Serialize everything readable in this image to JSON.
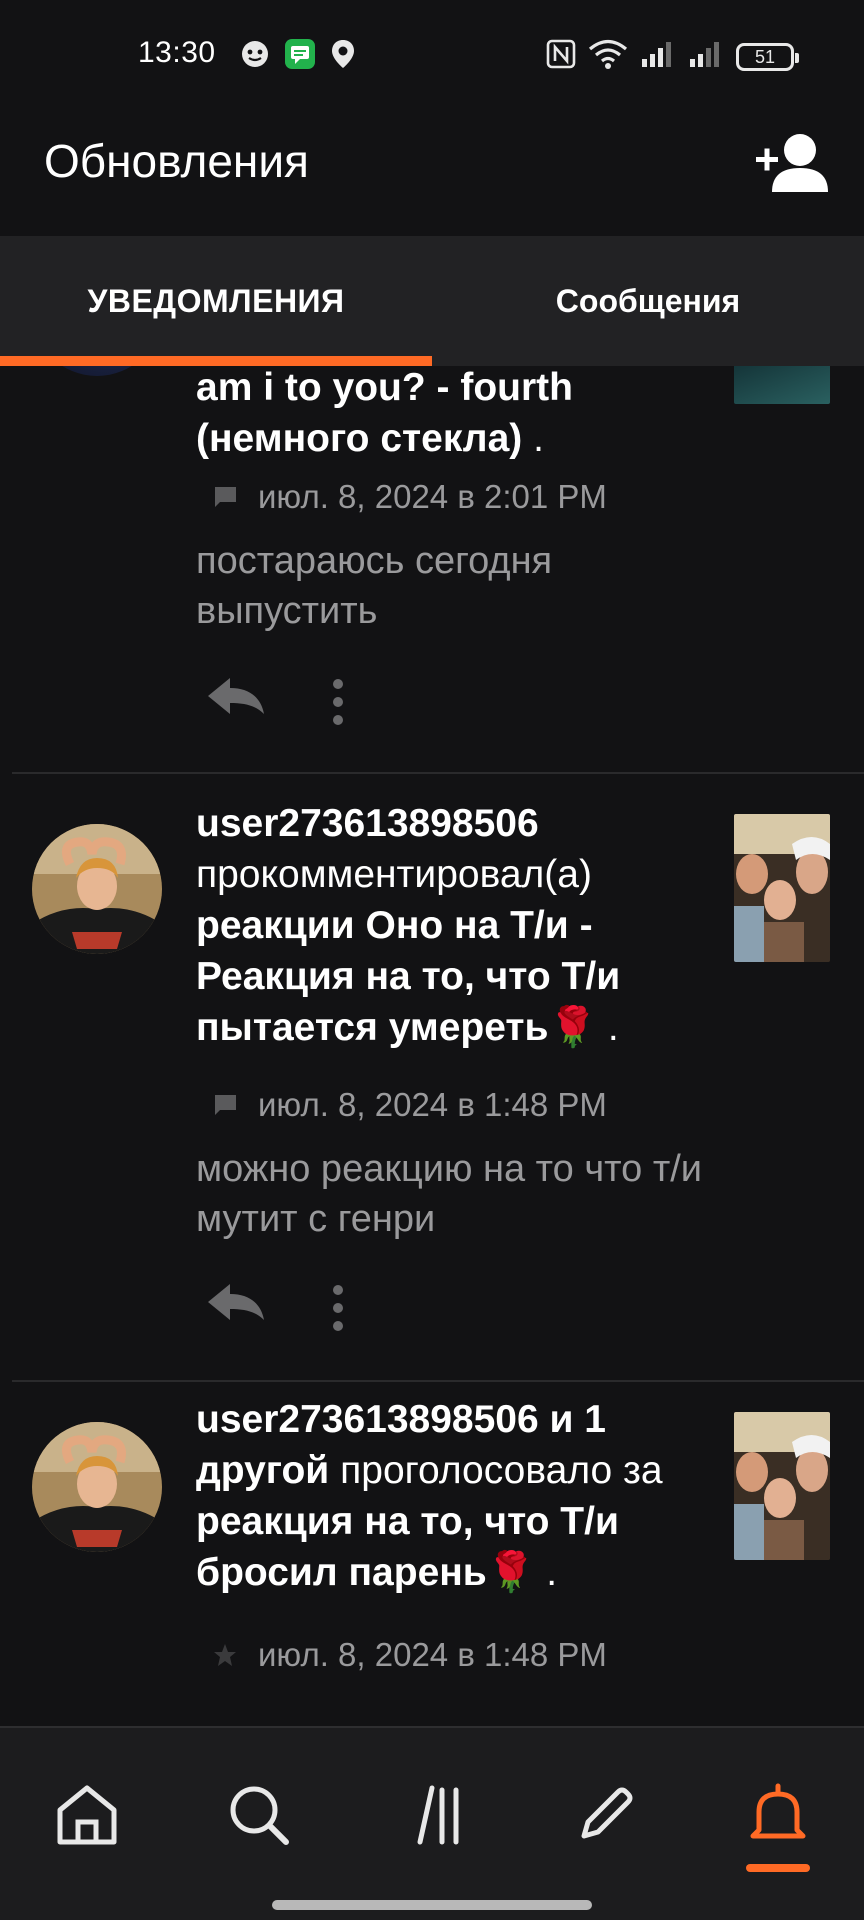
{
  "status_bar": {
    "time": "13:30",
    "battery": "51",
    "icons_left": [
      "face-icon",
      "chat-app-icon",
      "location-icon"
    ],
    "icons_right": [
      "nfc-icon",
      "wifi-icon",
      "signal-icon",
      "signal-icon",
      "battery-icon"
    ]
  },
  "header": {
    "title": "Обновления",
    "action_icon": "add-user-icon"
  },
  "tabs": [
    {
      "label": "УВЕДОМЛЕНИЯ",
      "active": true
    },
    {
      "label": "Сообщения",
      "active": false
    }
  ],
  "feed": {
    "items": [
      {
        "story_title_tail": "am i to you? - fourth (немного стекла)",
        "trailing": " .",
        "meta_icon": "comment-icon",
        "timestamp": "июл. 8, 2024 в 2:01 PM",
        "snippet": "постараюсь сегодня выпустить"
      },
      {
        "username": "user273613898506",
        "action": "прокомментировал(а)",
        "story_title": "реакции Оно на Т/и - Реакция на то, что Т/и пытается умереть🌹",
        "trailing": " .",
        "meta_icon": "comment-icon",
        "timestamp": "июл. 8, 2024 в 1:48 PM",
        "snippet": "можно реакцию на то что т/и мутит с  генри"
      },
      {
        "username_and_others": "user273613898506 и 1 другой",
        "action": "проголосовало за",
        "story_title": "реакция на то, что Т/и бросил парень🌹",
        "trailing": " .",
        "meta_icon": "star-icon",
        "timestamp": "июл. 8, 2024 в 1:48 PM"
      }
    ]
  },
  "bottom_nav": {
    "items": [
      "home-icon",
      "search-icon",
      "library-icon",
      "write-icon",
      "bell-icon"
    ],
    "active": "bell-icon"
  },
  "colors": {
    "accent": "#ff6a25",
    "background": "#121214",
    "tab_bar": "#222224",
    "muted_text": "#9a9a9c"
  }
}
